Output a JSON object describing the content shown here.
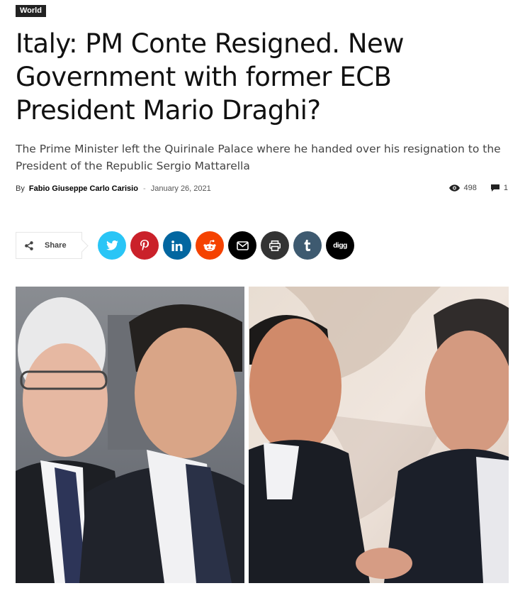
{
  "article": {
    "category": "World",
    "title": "Italy: PM Conte Resigned. New Government with former ECB President Mario Draghi?",
    "subtitle": "The Prime Minister left the Quirinale Palace where he handed over his resignation to the President of the Republic Sergio Mattarella",
    "by_label": "By",
    "author": "Fabio Giuseppe Carlo Carisio",
    "separator": "-",
    "date": "January 26, 2021",
    "views": "498",
    "comments": "1"
  },
  "share": {
    "label": "Share",
    "icon": "share-icon",
    "buttons": [
      {
        "name": "twitter",
        "icon": "twitter-icon",
        "color": "#29c5f6"
      },
      {
        "name": "pinterest",
        "icon": "pinterest-icon",
        "color": "#ca212a"
      },
      {
        "name": "linkedin",
        "icon": "linkedin-icon",
        "color": "#0266a0"
      },
      {
        "name": "reddit",
        "icon": "reddit-icon",
        "color": "#f54200"
      },
      {
        "name": "email",
        "icon": "envelope-icon",
        "color": "#000000"
      },
      {
        "name": "print",
        "icon": "printer-icon",
        "color": "#333333"
      },
      {
        "name": "tumblr",
        "icon": "tumblr-icon",
        "color": "#3e5a70"
      },
      {
        "name": "digg",
        "icon": "digg-icon",
        "color": "#000000"
      }
    ]
  },
  "image": {
    "description": "Split photo: Mattarella and Conte on the left; Berlusconi and Draghi on the right"
  }
}
